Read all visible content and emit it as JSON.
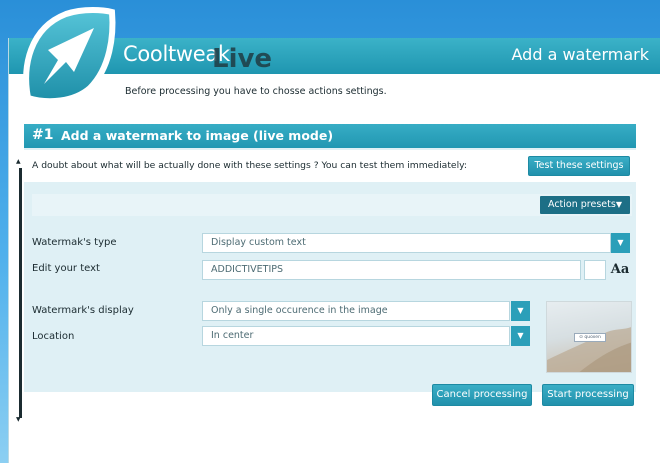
{
  "app": {
    "title": "Cooltweak",
    "title_suffix": "Live",
    "header_right": "Add a watermark",
    "subtitle": "Before processing you have to chosse actions settings."
  },
  "section": {
    "number": "#1",
    "title": "Add a watermark to image (live mode)",
    "test_text": "A doubt about what will be actually done with these settings ? You can test them immediately:",
    "test_button": "Test these settings",
    "presets_button": "Action presets"
  },
  "form": {
    "type_label": "Watermak's type",
    "type_value": "Display custom text",
    "text_label": "Edit your text",
    "text_value": "ADDICTIVETIPS",
    "font_glyph": "Aa",
    "display_label": "Watermark's display",
    "display_value": "Only a single occurence in the image",
    "location_label": "Location",
    "location_value": "In center"
  },
  "preview": {
    "watermark_text": "⊙ quoxen"
  },
  "footer": {
    "cancel": "Cancel processing",
    "start": "Start processing"
  },
  "icons": {
    "logo": "cursor-arrow-leaf-icon",
    "dropdown": "chevron-down-icon",
    "presets": "caret-down-icon"
  },
  "colors": {
    "accent": "#2197b2",
    "accent_dark": "#1d6f86",
    "panel": "#dff0f5"
  }
}
